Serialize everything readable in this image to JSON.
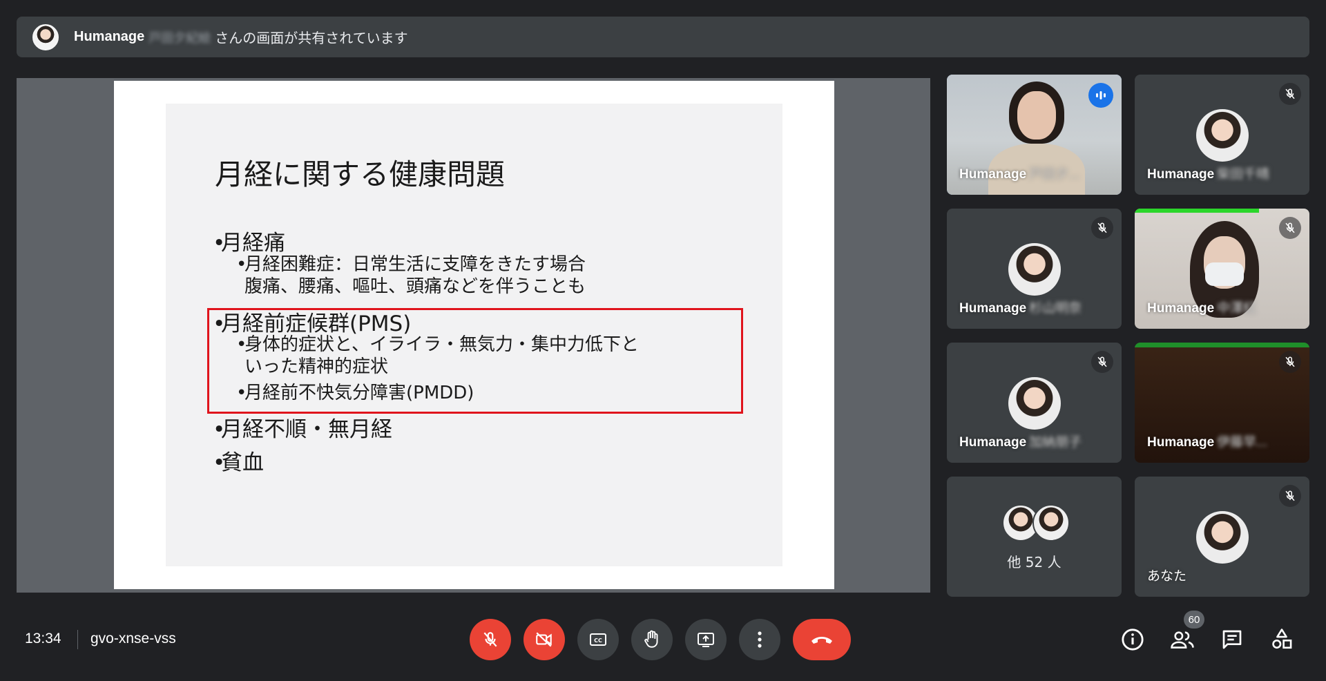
{
  "banner": {
    "presenter_name": "Humanage",
    "presenter_name_blurred": "戸田夕紀絵",
    "message": "さんの画面が共有されています"
  },
  "slide": {
    "title": "月経に関する健康問題",
    "bullets": [
      {
        "text": "月経痛",
        "sub": [
          "月経困難症：日常生活に支障をきたす場合",
          "腹痛、腰痛、嘔吐、頭痛などを伴うことも"
        ]
      },
      {
        "text": "月経前症候群(PMS)",
        "sub": [
          "身体的症状と、イライラ・無気力・集中力低下と",
          "いった精神的症状",
          "月経前不快気分障害(PMDD)"
        ]
      },
      {
        "text": "月経不順・無月経",
        "sub": []
      },
      {
        "text": "貧血",
        "sub": []
      }
    ]
  },
  "participants": [
    {
      "name": "Humanage",
      "blurred": "戸田夕...",
      "speaking": true
    },
    {
      "name": "Humanage",
      "blurred": "柴田千晴",
      "muted": true
    },
    {
      "name": "Humanage",
      "blurred": "杉山明奈",
      "muted": true
    },
    {
      "name": "Humanage",
      "blurred": "中澤紅",
      "muted": true
    },
    {
      "name": "Humanage",
      "blurred": "加納朋子",
      "muted": true
    },
    {
      "name": "Humanage",
      "blurred": "伊藤早...",
      "muted": true
    },
    {
      "others_label": "他 52 人"
    },
    {
      "name": "あなた",
      "muted": true
    }
  ],
  "footer": {
    "time": "13:34",
    "meeting_code": "gvo-xnse-vss",
    "people_count": "60"
  },
  "icons": {
    "mic": "mic-off-icon",
    "camera": "videocam-off-icon",
    "captions": "closed-caption-icon",
    "hand": "raise-hand-icon",
    "present": "present-screen-icon",
    "more": "more-vert-icon",
    "end": "call-end-icon",
    "info": "info-icon",
    "people": "people-icon",
    "chat": "chat-icon",
    "activities": "activities-icon"
  },
  "colors": {
    "background": "#202124",
    "tile": "#3c4043",
    "danger": "#ea4335",
    "active_outline": "#8ab4f8",
    "speaking": "#1a73e8",
    "highlight_box": "#e0141c"
  }
}
